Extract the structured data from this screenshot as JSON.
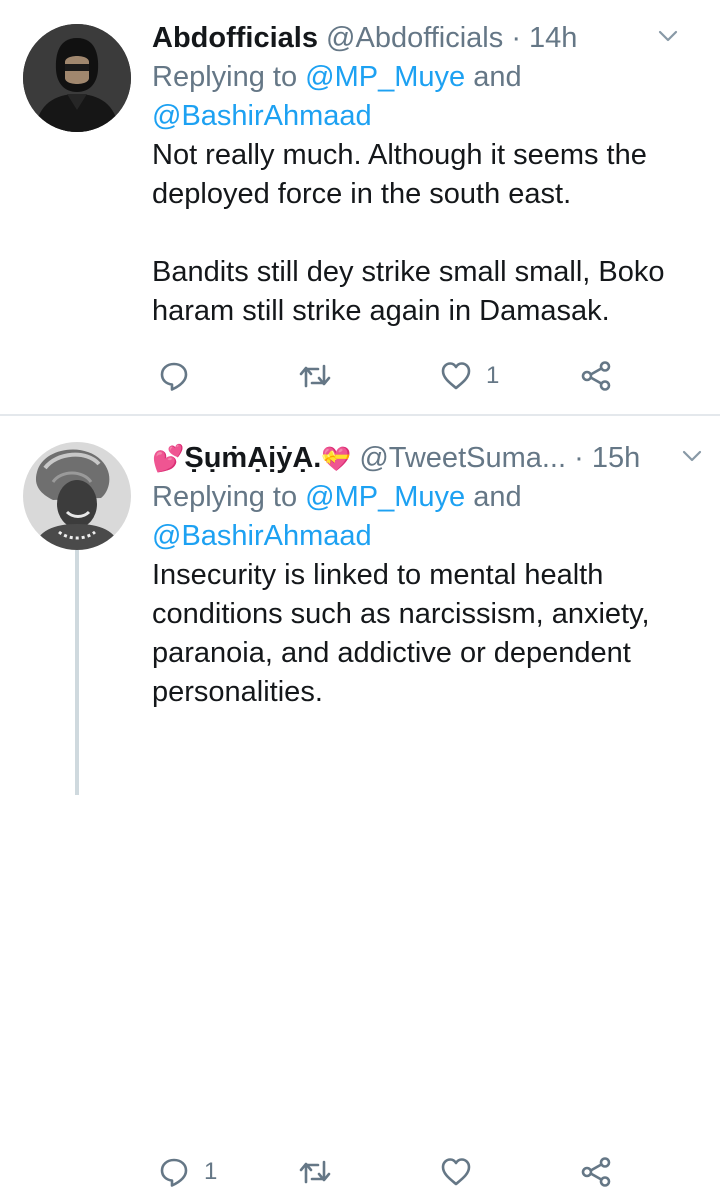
{
  "tweets": [
    {
      "display_name": "Abdofficials",
      "handle": "@Abdofficials",
      "time": "14h",
      "replying_prefix": "Replying to ",
      "mention_1": "@MP_Muye",
      "replying_and": " and",
      "mention_2": "@BashirAhmaad",
      "text": "Not really much. Although it seems the deployed force in the south east.\n\nBandits still dey strike small small, Boko haram still strike again in Damasak.",
      "reply_count": "",
      "retweet_count": "",
      "like_count": "1"
    },
    {
      "display_name_prefix": "💕",
      "display_name": "ṢụṁẠịẏẠ.",
      "display_name_suffix": "💝",
      "handle": "@TweetSuma...",
      "time": "15h",
      "replying_prefix": "Replying to ",
      "mention_1": "@MP_Muye",
      "replying_and": " and",
      "mention_2": "@BashirAhmaad",
      "text": "Insecurity is linked to mental health conditions such as narcissism, anxiety, paranoia, and addictive or dependent personalities.",
      "reply_count": "1",
      "retweet_count": "",
      "like_count": ""
    }
  ],
  "separator": "·",
  "icons": {
    "reply": "reply-icon",
    "retweet": "retweet-icon",
    "like": "heart-icon",
    "share": "share-icon",
    "menu": "chevron-down-icon"
  },
  "colors": {
    "text": "#14171a",
    "muted": "#657786",
    "link": "#1da1f2",
    "divider": "#e4e8ec"
  }
}
